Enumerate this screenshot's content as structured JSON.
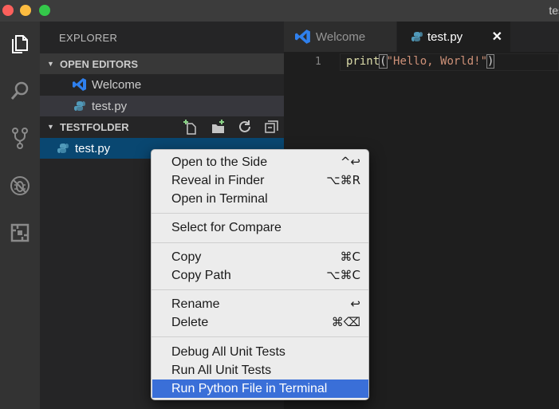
{
  "window": {
    "title": "tes"
  },
  "sidebar": {
    "title": "EXPLORER",
    "open_editors": {
      "label": "OPEN EDITORS",
      "items": [
        {
          "label": "Welcome",
          "icon": "vscode-icon"
        },
        {
          "label": "test.py",
          "icon": "python-icon"
        }
      ]
    },
    "folder": {
      "label": "TESTFOLDER",
      "items": [
        {
          "label": "test.py",
          "icon": "python-icon"
        }
      ]
    }
  },
  "tabs": [
    {
      "label": "Welcome",
      "icon": "vscode-icon"
    },
    {
      "label": "test.py",
      "icon": "python-icon",
      "close": "✕"
    }
  ],
  "editor": {
    "line_number": "1",
    "code": {
      "fn": "print",
      "open": "(",
      "string": "\"Hello, World!\"",
      "close": ")"
    }
  },
  "context_menu": {
    "groups": [
      [
        {
          "label": "Open to the Side",
          "shortcut": "^↩"
        },
        {
          "label": "Reveal in Finder",
          "shortcut": "⌥⌘R"
        },
        {
          "label": "Open in Terminal",
          "shortcut": ""
        }
      ],
      [
        {
          "label": "Select for Compare",
          "shortcut": ""
        }
      ],
      [
        {
          "label": "Copy",
          "shortcut": "⌘C"
        },
        {
          "label": "Copy Path",
          "shortcut": "⌥⌘C"
        }
      ],
      [
        {
          "label": "Rename",
          "shortcut": "↩"
        },
        {
          "label": "Delete",
          "shortcut": "⌘⌫"
        }
      ],
      [
        {
          "label": "Debug All Unit Tests",
          "shortcut": ""
        },
        {
          "label": "Run All Unit Tests",
          "shortcut": ""
        },
        {
          "label": "Run Python File in Terminal",
          "shortcut": "",
          "highlighted": true
        }
      ]
    ]
  },
  "colors": {
    "accent_selection": "#094771",
    "menu_highlight": "#3a6fd8",
    "python_blue": "#519aba"
  }
}
